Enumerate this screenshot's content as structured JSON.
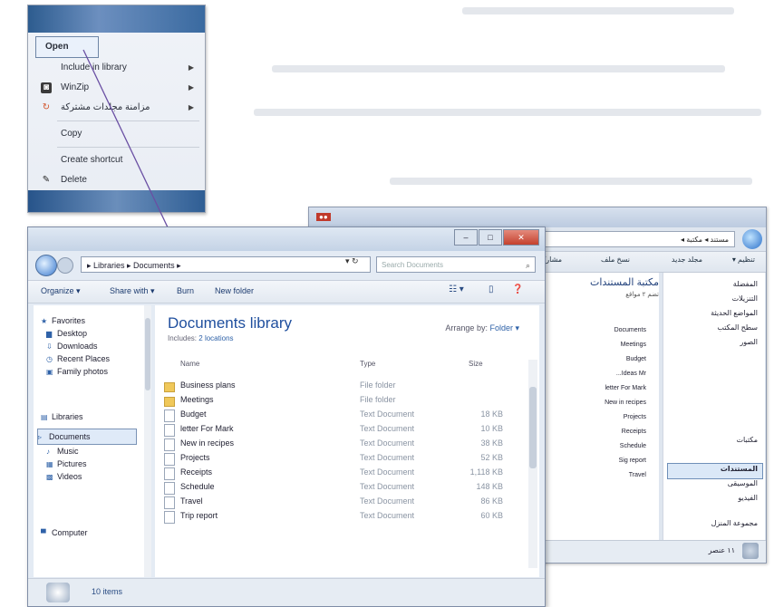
{
  "background_text": {
    "lines": 6
  },
  "context_menu": {
    "items": [
      {
        "label": "Open",
        "icon": "",
        "submenu": false
      },
      {
        "label": "Include in library",
        "icon": "",
        "submenu": true
      },
      {
        "label": "WinZip",
        "icon": "winzip-icon",
        "submenu": true
      },
      {
        "label": "مزامنة مجلدات مشتركة",
        "icon": "sync-icon",
        "submenu": true
      },
      {
        "label": "Copy",
        "icon": "",
        "submenu": false
      },
      {
        "label": "Create shortcut",
        "icon": "",
        "submenu": false
      },
      {
        "label": "Delete",
        "icon": "delete-icon",
        "submenu": false
      }
    ]
  },
  "arabic_window": {
    "address": "مستند ◂ مكتبة ◂",
    "toolbar": [
      "مشاركة مع ▾",
      "نسخ ملف",
      "مجلد جديد",
      "تنظيم ▾"
    ],
    "library_title": "مكتبة المستندات",
    "library_subtitle": "تضم ٢ مواقع",
    "files": [
      "Documents",
      "Meetings",
      "Budget",
      "Ideas Mr...",
      "letter For Mark",
      "New in recipes",
      "Projects",
      "Receipts",
      "Schedule",
      "Sig report",
      "Travel"
    ],
    "nav": [
      "المفضلة",
      "التنزيلات",
      "المواضع الحديثة",
      "سطح المكتب",
      "الصور",
      "مكتبات",
      "المستندات",
      "الموسيقى",
      "الفيديو",
      "مجموعة المنزل"
    ],
    "status": "١١ عنصر"
  },
  "documents_window": {
    "address": "▸ Libraries ▸ Documents ▸",
    "search_placeholder": "Search Documents",
    "toolbar": {
      "organize": "Organize ▾",
      "share": "Share with ▾",
      "burn": "Burn",
      "new_folder": "New folder"
    },
    "nav_groups": [
      {
        "label": "Favorites",
        "y": 0
      },
      {
        "label": "Libraries",
        "y": 0
      }
    ],
    "nav_items": [
      {
        "label": "Favorites",
        "icon": "star-icon"
      },
      {
        "label": "Desktop",
        "icon": "desktop-icon"
      },
      {
        "label": "Downloads",
        "icon": "downloads-icon"
      },
      {
        "label": "Recent Places",
        "icon": "recent-icon"
      },
      {
        "label": "Family photos",
        "icon": "folder-icon"
      },
      {
        "label": "Libraries",
        "icon": "library-icon"
      },
      {
        "label": "Documents",
        "icon": "documents-icon"
      },
      {
        "label": "Music",
        "icon": "music-icon"
      },
      {
        "label": "Pictures",
        "icon": "pictures-icon"
      },
      {
        "label": "Videos",
        "icon": "videos-icon"
      },
      {
        "label": "Computer",
        "icon": "computer-icon"
      }
    ],
    "library_title": "Documents library",
    "includes_label": "Includes:",
    "includes_value": "2 locations",
    "arrange_label": "Arrange by:",
    "arrange_value": "Folder ▾",
    "columns": {
      "name": "Name",
      "type": "Type",
      "size": "Size"
    },
    "files": [
      {
        "name": "Business plans",
        "type": "File folder",
        "size": "",
        "folder": true
      },
      {
        "name": "Meetings",
        "type": "File folder",
        "size": "",
        "folder": true
      },
      {
        "name": "Budget",
        "type": "Text Document",
        "size": "18 KB",
        "folder": false
      },
      {
        "name": "letter For Mark",
        "type": "Text Document",
        "size": "10 KB",
        "folder": false
      },
      {
        "name": "New in recipes",
        "type": "Text Document",
        "size": "38 KB",
        "folder": false
      },
      {
        "name": "Projects",
        "type": "Text Document",
        "size": "52 KB",
        "folder": false
      },
      {
        "name": "Receipts",
        "type": "Text Document",
        "size": "1,118 KB",
        "folder": false
      },
      {
        "name": "Schedule",
        "type": "Text Document",
        "size": "148 KB",
        "folder": false
      },
      {
        "name": "Travel",
        "type": "Text Document",
        "size": "86 KB",
        "folder": false
      },
      {
        "name": "Trip report",
        "type": "Text Document",
        "size": "60 KB",
        "folder": false
      }
    ],
    "status_count": "10 items"
  }
}
